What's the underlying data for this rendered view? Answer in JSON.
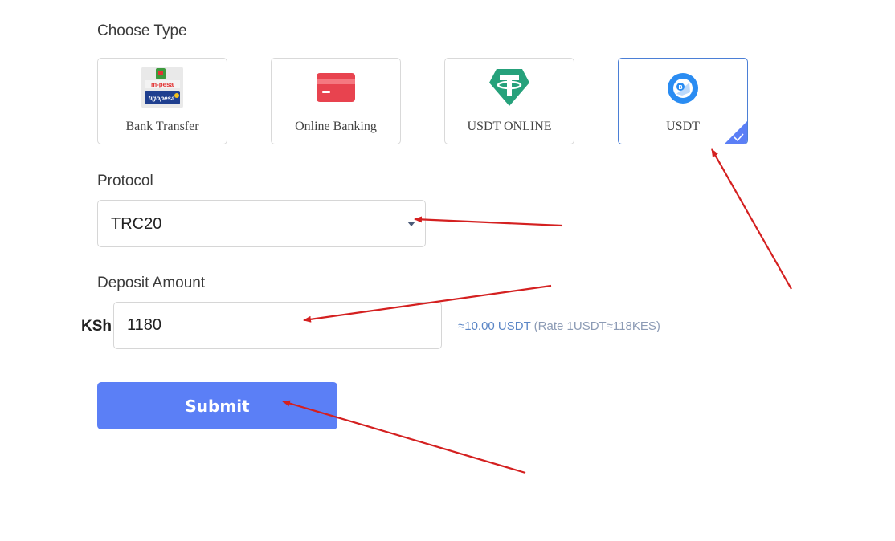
{
  "choose_type": {
    "label": "Choose Type",
    "options": [
      {
        "label": "Bank Transfer",
        "icon": "mpesa-tigopesa-logo"
      },
      {
        "label": "Online Banking",
        "icon": "card-icon"
      },
      {
        "label": "USDT ONLINE",
        "icon": "tether-icon"
      },
      {
        "label": "USDT",
        "icon": "usdt-coin-icon",
        "selected": true
      }
    ]
  },
  "protocol": {
    "label": "Protocol",
    "selected": "TRC20"
  },
  "deposit": {
    "label": "Deposit Amount",
    "currency_prefix": "KSh",
    "value": "1180",
    "conversion": "≈10.00 USDT",
    "rate": "(Rate 1USDT≈118KES)"
  },
  "submit": {
    "label": "Submit"
  },
  "colors": {
    "accent": "#5b7ff6",
    "selected_border": "#4b7fd6",
    "annotation_arrow": "#d42020",
    "tether_green": "#26a17b",
    "card_red": "#e8434f"
  },
  "logo_text": {
    "mpesa": "m-pesa",
    "tigopesa": "tigopesa"
  }
}
